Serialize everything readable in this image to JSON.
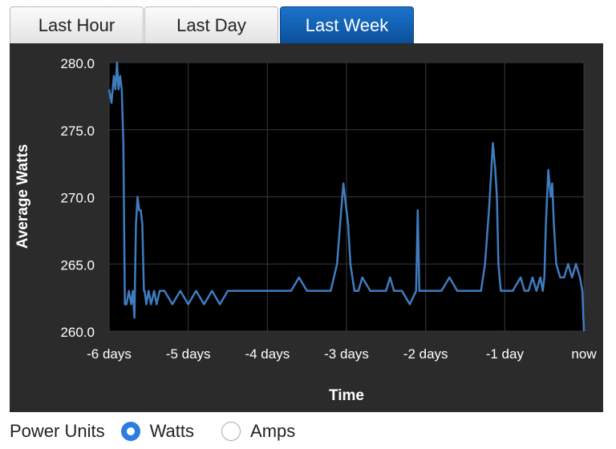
{
  "tabs": [
    {
      "label": "Last Hour",
      "active": false
    },
    {
      "label": "Last Day",
      "active": false
    },
    {
      "label": "Last Week",
      "active": true
    }
  ],
  "units": {
    "label": "Power Units",
    "options": [
      {
        "label": "Watts",
        "selected": true
      },
      {
        "label": "Amps",
        "selected": false
      }
    ]
  },
  "colors": {
    "panel_bg": "#2b2b2b",
    "plot_bg": "#000000",
    "grid": "#3a3a3a",
    "line": "#3f7cbf",
    "text": "#ffffff",
    "tab_active": "#0c5db0",
    "radio_selected": "#2b7de0"
  },
  "chart_data": {
    "type": "line",
    "title": "",
    "xlabel": "Time",
    "ylabel": "Average Watts",
    "x_unit": "days before now",
    "xlim": [
      -6,
      0
    ],
    "ylim": [
      260,
      280
    ],
    "grid": true,
    "x_ticks": [
      -6,
      -5,
      -4,
      -3,
      -2,
      -1,
      0
    ],
    "x_tick_labels": [
      "-6 days",
      "-5 days",
      "-4 days",
      "-3 days",
      "-2 days",
      "-1 day",
      "now"
    ],
    "y_ticks": [
      260,
      265,
      270,
      275,
      280
    ],
    "y_tick_labels": [
      "260.0",
      "265.0",
      "270.0",
      "275.0",
      "280.0"
    ],
    "series": [
      {
        "x": [
          -6.0,
          -5.97,
          -5.94,
          -5.92,
          -5.9,
          -5.88,
          -5.86,
          -5.84,
          -5.82,
          -5.8,
          -5.78,
          -5.75,
          -5.72,
          -5.7,
          -5.68,
          -5.66,
          -5.64,
          -5.62,
          -5.6,
          -5.58,
          -5.56,
          -5.55,
          -5.53,
          -5.5,
          -5.47,
          -5.43,
          -5.4,
          -5.36,
          -5.3,
          -5.2,
          -5.1,
          -5.0,
          -4.9,
          -4.8,
          -4.7,
          -4.6,
          -4.5,
          -4.4,
          -4.3,
          -4.2,
          -4.1,
          -4.0,
          -3.9,
          -3.8,
          -3.7,
          -3.6,
          -3.5,
          -3.4,
          -3.3,
          -3.2,
          -3.12,
          -3.08,
          -3.04,
          -3.0,
          -2.98,
          -2.95,
          -2.9,
          -2.85,
          -2.8,
          -2.7,
          -2.6,
          -2.55,
          -2.5,
          -2.45,
          -2.4,
          -2.3,
          -2.2,
          -2.12,
          -2.1,
          -2.08,
          -2.0,
          -1.9,
          -1.8,
          -1.7,
          -1.6,
          -1.5,
          -1.4,
          -1.3,
          -1.25,
          -1.2,
          -1.17,
          -1.15,
          -1.12,
          -1.1,
          -1.08,
          -1.05,
          -1.0,
          -0.9,
          -0.8,
          -0.75,
          -0.7,
          -0.65,
          -0.6,
          -0.55,
          -0.52,
          -0.5,
          -0.48,
          -0.45,
          -0.42,
          -0.4,
          -0.38,
          -0.35,
          -0.3,
          -0.25,
          -0.2,
          -0.15,
          -0.1,
          -0.05,
          -0.02,
          0.0
        ],
        "y": [
          278,
          277,
          279,
          278,
          280,
          278,
          279,
          278,
          274,
          262,
          262,
          263,
          262,
          263,
          261,
          268,
          270,
          269,
          269,
          268,
          263,
          263,
          262,
          263,
          262,
          263,
          262,
          263,
          263,
          262,
          263,
          262,
          263,
          262,
          263,
          262,
          263,
          263,
          263,
          263,
          263,
          263,
          263,
          263,
          263,
          264,
          263,
          263,
          263,
          263,
          265,
          268,
          271,
          269,
          268,
          265,
          263,
          263,
          264,
          263,
          263,
          263,
          263,
          264,
          263,
          263,
          262,
          263,
          269,
          263,
          263,
          263,
          263,
          264,
          263,
          263,
          263,
          263,
          265,
          269,
          272,
          274,
          272,
          270,
          265,
          263,
          263,
          263,
          264,
          263,
          263,
          264,
          263,
          264,
          263,
          264,
          268,
          272,
          270,
          271,
          268,
          265,
          264,
          264,
          265,
          264,
          265,
          264,
          263,
          260
        ]
      }
    ]
  }
}
